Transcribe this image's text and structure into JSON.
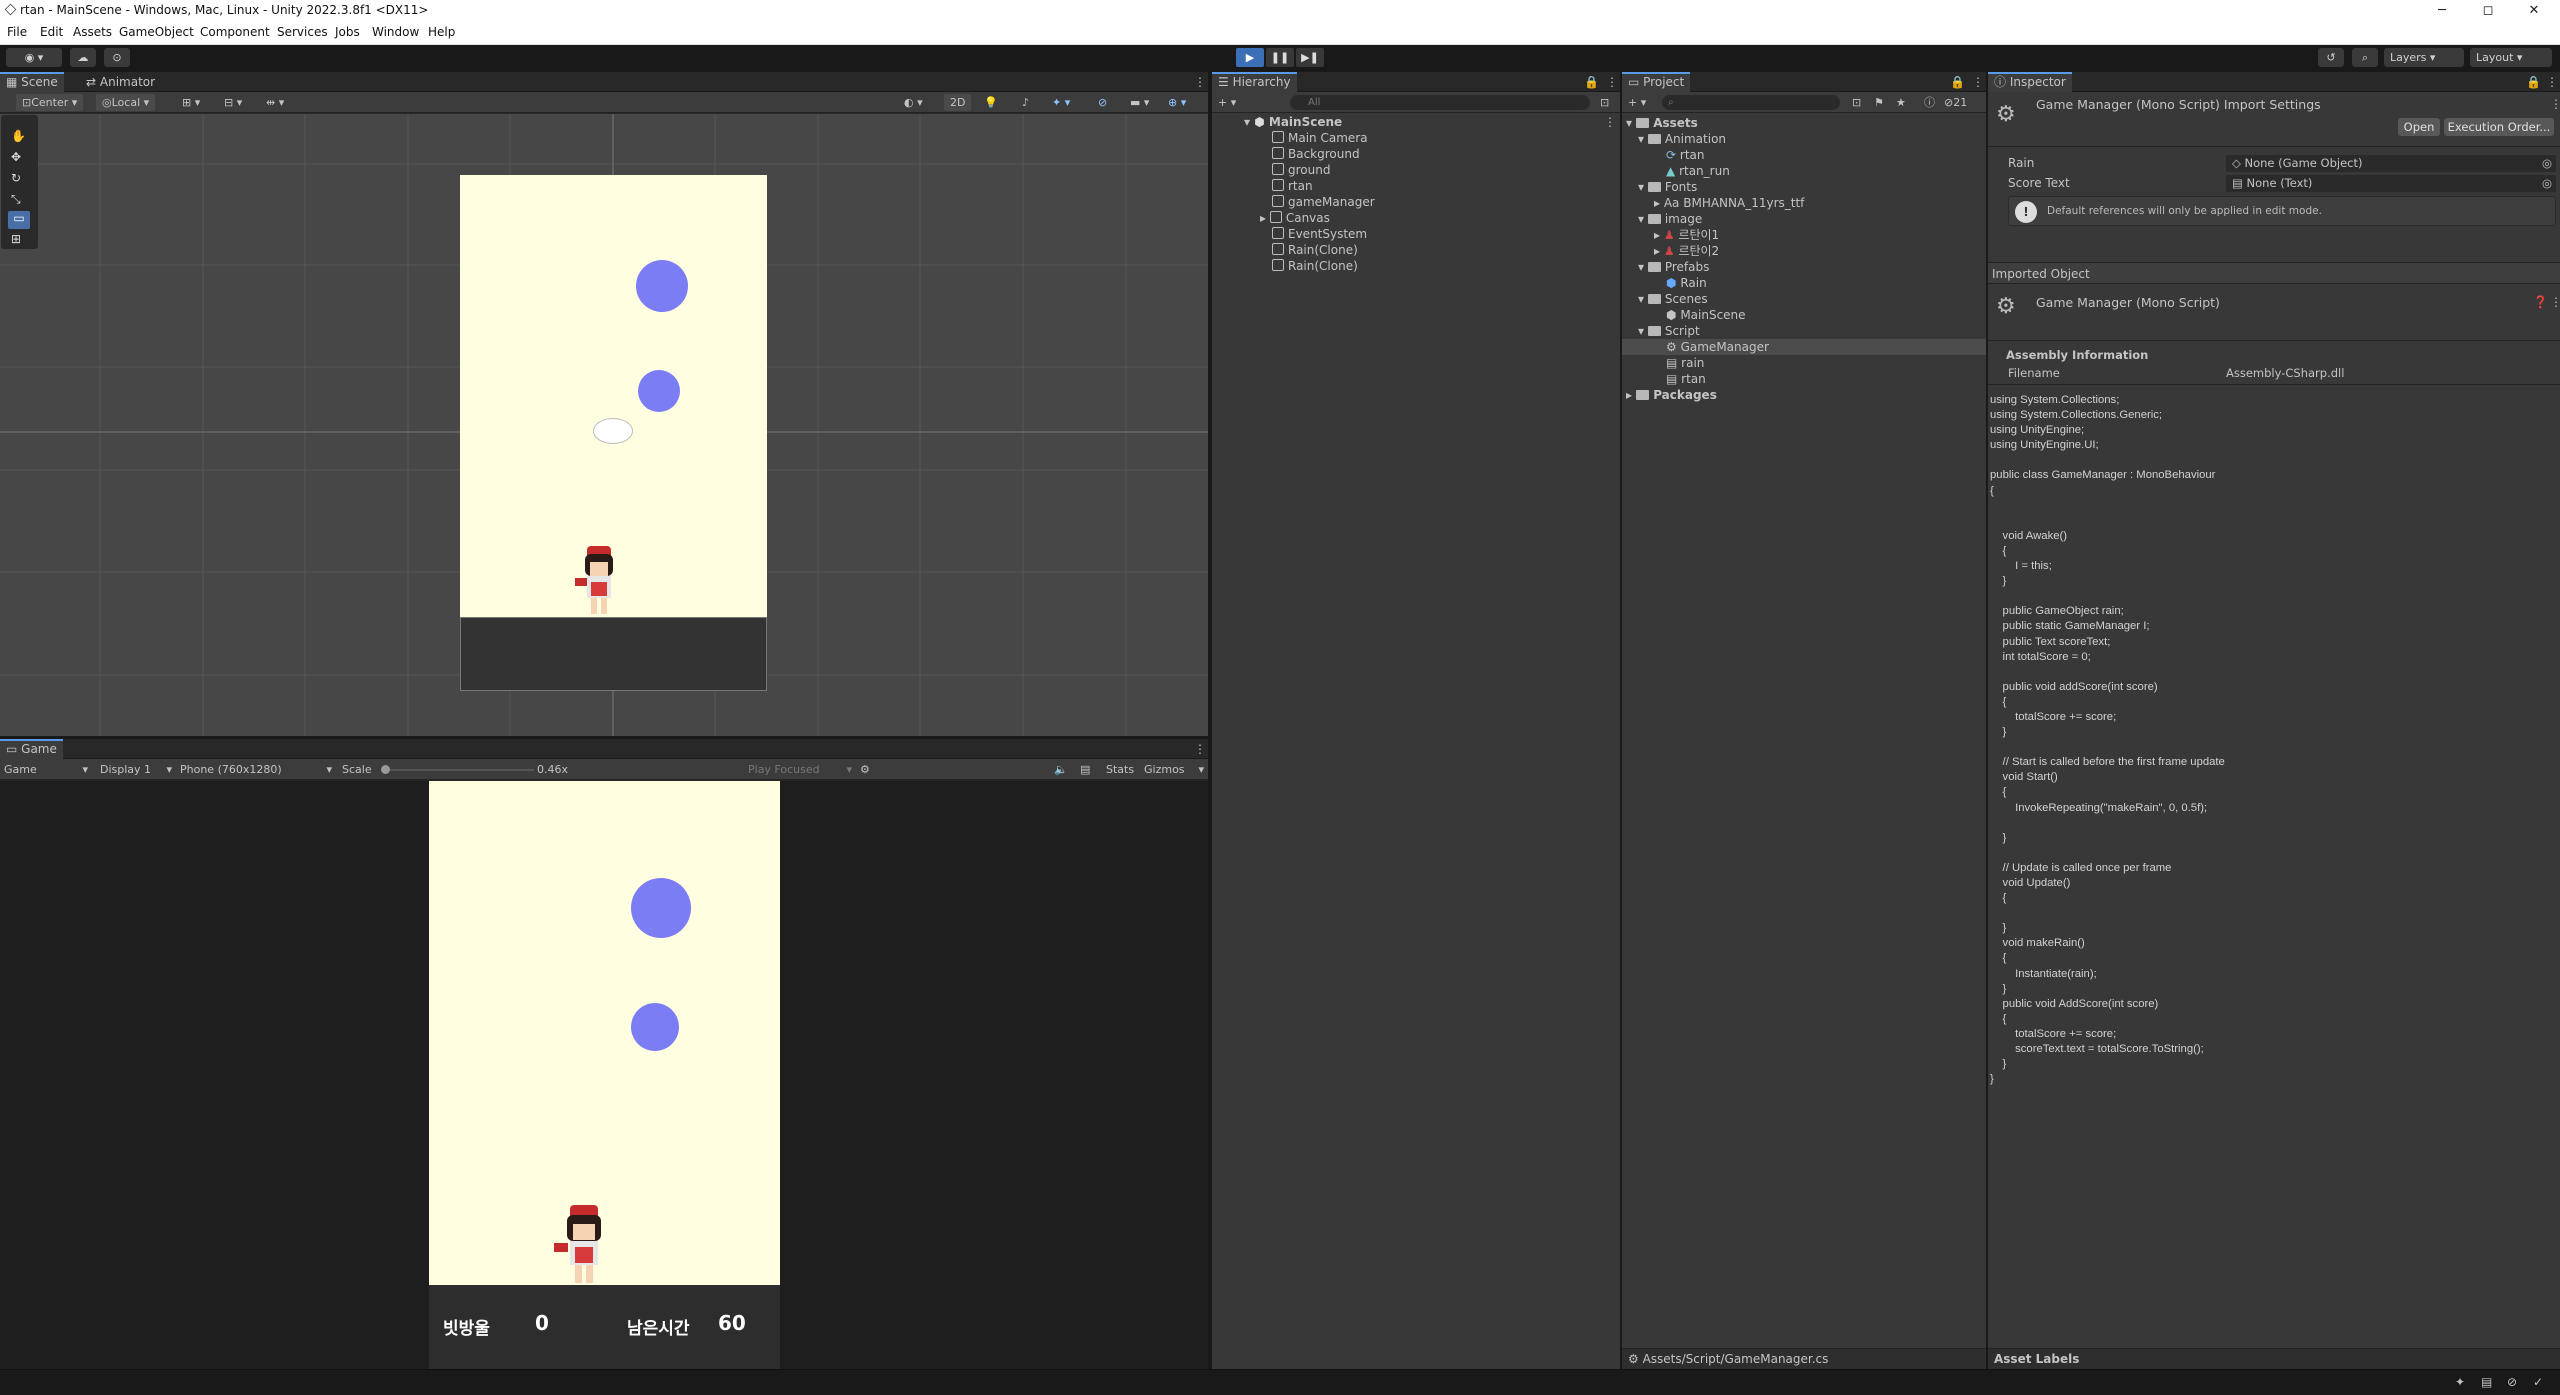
{
  "window": {
    "title": "rtan - MainScene - Windows, Mac, Linux - Unity 2022.3.8f1 <DX11>",
    "minimize": "─",
    "maximize": "◻",
    "close": "✕"
  },
  "menu": [
    "File",
    "Edit",
    "Assets",
    "GameObject",
    "Component",
    "Services",
    "Jobs",
    "Window",
    "Help"
  ],
  "toolbar": {
    "play": "▶",
    "pause": "❚❚",
    "step": "▶❚",
    "layers": "Layers",
    "layout": "Layout"
  },
  "scene": {
    "tab_scene": "Scene",
    "tab_animator": "Animator",
    "pivot": "Center",
    "space": "Local",
    "mode2d": "2D"
  },
  "game": {
    "tab": "Game",
    "view": "Game",
    "display": "Display 1",
    "resolution": "Phone (760x1280)",
    "scale_label": "Scale",
    "scale_value": "0.46x",
    "play_focused": "Play Focused",
    "stats": "Stats",
    "gizmos": "Gizmos",
    "score_label": "빗방울",
    "score_value": "0",
    "time_label": "남은시간",
    "time_value": "60",
    "bg_color": "#fffee0",
    "circle_color": "#7b7df5"
  },
  "hierarchy": {
    "tab": "Hierarchy",
    "search_placeholder": "All",
    "scene": "MainScene",
    "items": [
      "Main Camera",
      "Background",
      "ground",
      "rtan",
      "gameManager",
      "Canvas",
      "EventSystem",
      "Rain(Clone)",
      "Rain(Clone)"
    ]
  },
  "project": {
    "tab": "Project",
    "hidden_count": "21",
    "root": "Assets",
    "animation": "Animation",
    "anim_items": [
      "rtan",
      "rtan_run"
    ],
    "fonts": "Fonts",
    "font_item": "BMHANNA_11yrs_ttf",
    "image": "image",
    "image_items": [
      "르탄이1",
      "르탄이2"
    ],
    "prefabs": "Prefabs",
    "prefab_item": "Rain",
    "scenes": "Scenes",
    "scene_item": "MainScene",
    "script": "Script",
    "script_items": [
      "GameManager",
      "rain",
      "rtan"
    ],
    "packages": "Packages",
    "path": "Assets/Script/GameManager.cs"
  },
  "inspector": {
    "tab": "Inspector",
    "header": "Game Manager (Mono Script) Import Settings",
    "open": "Open",
    "exec_order": "Execution Order...",
    "rain_label": "Rain",
    "rain_value": "None (Game Object)",
    "score_text_label": "Score Text",
    "score_text_value": "None (Text)",
    "notice": "Default references will only be applied in edit mode.",
    "imported": "Imported Object",
    "imported_name": "Game Manager (Mono Script)",
    "assembly_info": "Assembly Information",
    "filename_label": "Filename",
    "filename_value": "Assembly-CSharp.dll",
    "asset_labels": "Asset Labels",
    "code": "using System.Collections;\nusing System.Collections.Generic;\nusing UnityEngine;\nusing UnityEngine.UI;\n\npublic class GameManager : MonoBehaviour\n{\n\n\n    void Awake()\n    {\n        I = this;\n    }\n\n    public GameObject rain;\n    public static GameManager I;\n    public Text scoreText;\n    int totalScore = 0;\n\n    public void addScore(int score)\n    {\n        totalScore += score;\n    }\n\n    // Start is called before the first frame update\n    void Start()\n    {\n        InvokeRepeating(\"makeRain\", 0, 0.5f);\n\n    }\n\n    // Update is called once per frame\n    void Update()\n    {\n\n    }\n    void makeRain()\n    {\n        Instantiate(rain);\n    }\n    public void AddScore(int score)\n    {\n        totalScore += score;\n        scoreText.text = totalScore.ToString();\n    }\n}"
  }
}
